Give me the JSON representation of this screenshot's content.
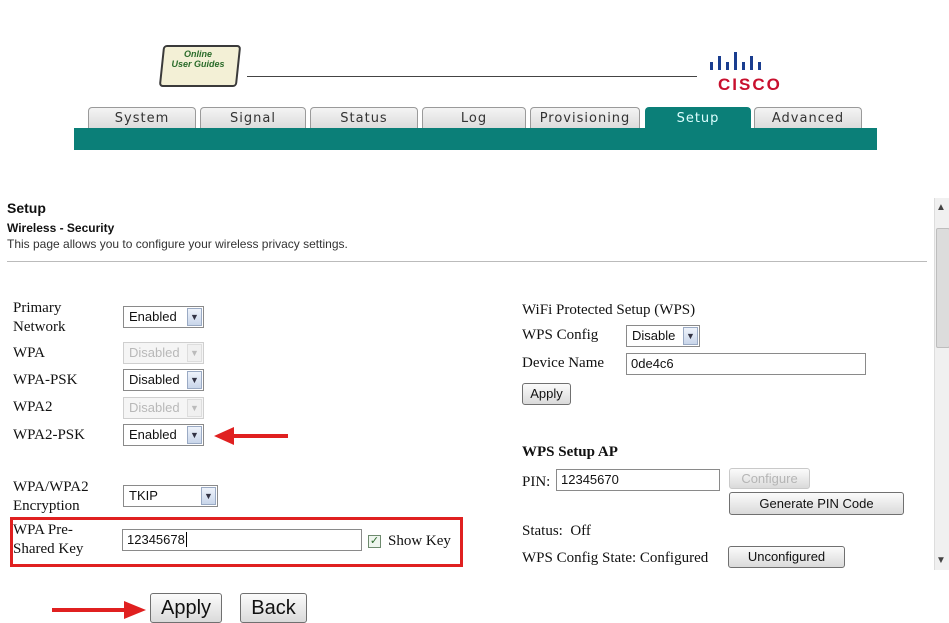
{
  "header": {
    "logo_line1": "Online",
    "logo_line2": "User Guides",
    "brand": "CISCO"
  },
  "tabs": [
    {
      "label": "System"
    },
    {
      "label": "Signal"
    },
    {
      "label": "Status"
    },
    {
      "label": "Log"
    },
    {
      "label": "Provisioning"
    },
    {
      "label": "Setup",
      "active": true
    },
    {
      "label": "Advanced"
    }
  ],
  "page": {
    "title": "Setup",
    "subtitle": "Wireless - Security",
    "description": "This page allows you to configure your wireless privacy settings."
  },
  "left_form": {
    "primary_network": {
      "label_line1": "Primary",
      "label_line2": "Network",
      "value": "Enabled"
    },
    "wpa": {
      "label": "WPA",
      "value": "Disabled"
    },
    "wpa_psk": {
      "label": "WPA-PSK",
      "value": "Disabled"
    },
    "wpa2": {
      "label": "WPA2",
      "value": "Disabled"
    },
    "wpa2_psk": {
      "label": "WPA2-PSK",
      "value": "Enabled"
    },
    "encryption": {
      "label_line1": "WPA/WPA2",
      "label_line2": "Encryption",
      "value": "TKIP"
    },
    "psk": {
      "label_line1": "WPA Pre-",
      "label_line2": "Shared Key",
      "value": "12345678",
      "show_key_label": "Show Key",
      "show_key_checked": true
    }
  },
  "wps": {
    "title": "WiFi Protected Setup (WPS)",
    "config_label": "WPS Config",
    "config_value": "Disable",
    "device_name_label": "Device Name",
    "device_name_value": "0de4c6",
    "apply_label": "Apply",
    "setup_ap_title": "WPS Setup AP",
    "pin_label": "PIN:",
    "pin_value": "12345670",
    "configure_label": "Configure",
    "generate_pin_label": "Generate PIN Code",
    "status_label": "Status:",
    "status_value": "Off",
    "config_state_label": "WPS Config State:",
    "config_state_value": "Configured",
    "unconfigured_label": "Unconfigured"
  },
  "footer": {
    "apply_label": "Apply",
    "back_label": "Back"
  },
  "colors": {
    "teal": "#0b7f78",
    "annotation_red": "#e02020",
    "cisco_red": "#c8102e"
  }
}
